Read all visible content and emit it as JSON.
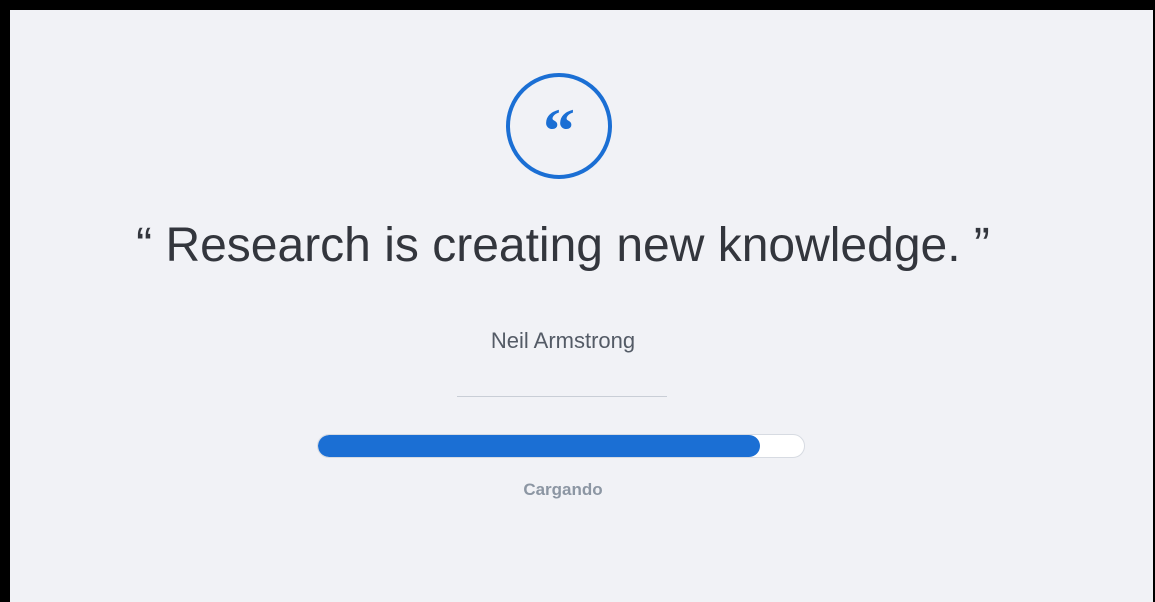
{
  "colors": {
    "background": "#f1f2f6",
    "accent": "#1b6fd4",
    "quote_text": "#33363d",
    "author_text": "#545b66",
    "label_text": "#8c96a3"
  },
  "icon": {
    "name": "quote-icon",
    "glyph": "“"
  },
  "quote": {
    "text": "“ Research is creating new knowledge. ”",
    "author": "Neil Armstrong"
  },
  "loader": {
    "progress": 0.91,
    "label": "Cargando"
  }
}
